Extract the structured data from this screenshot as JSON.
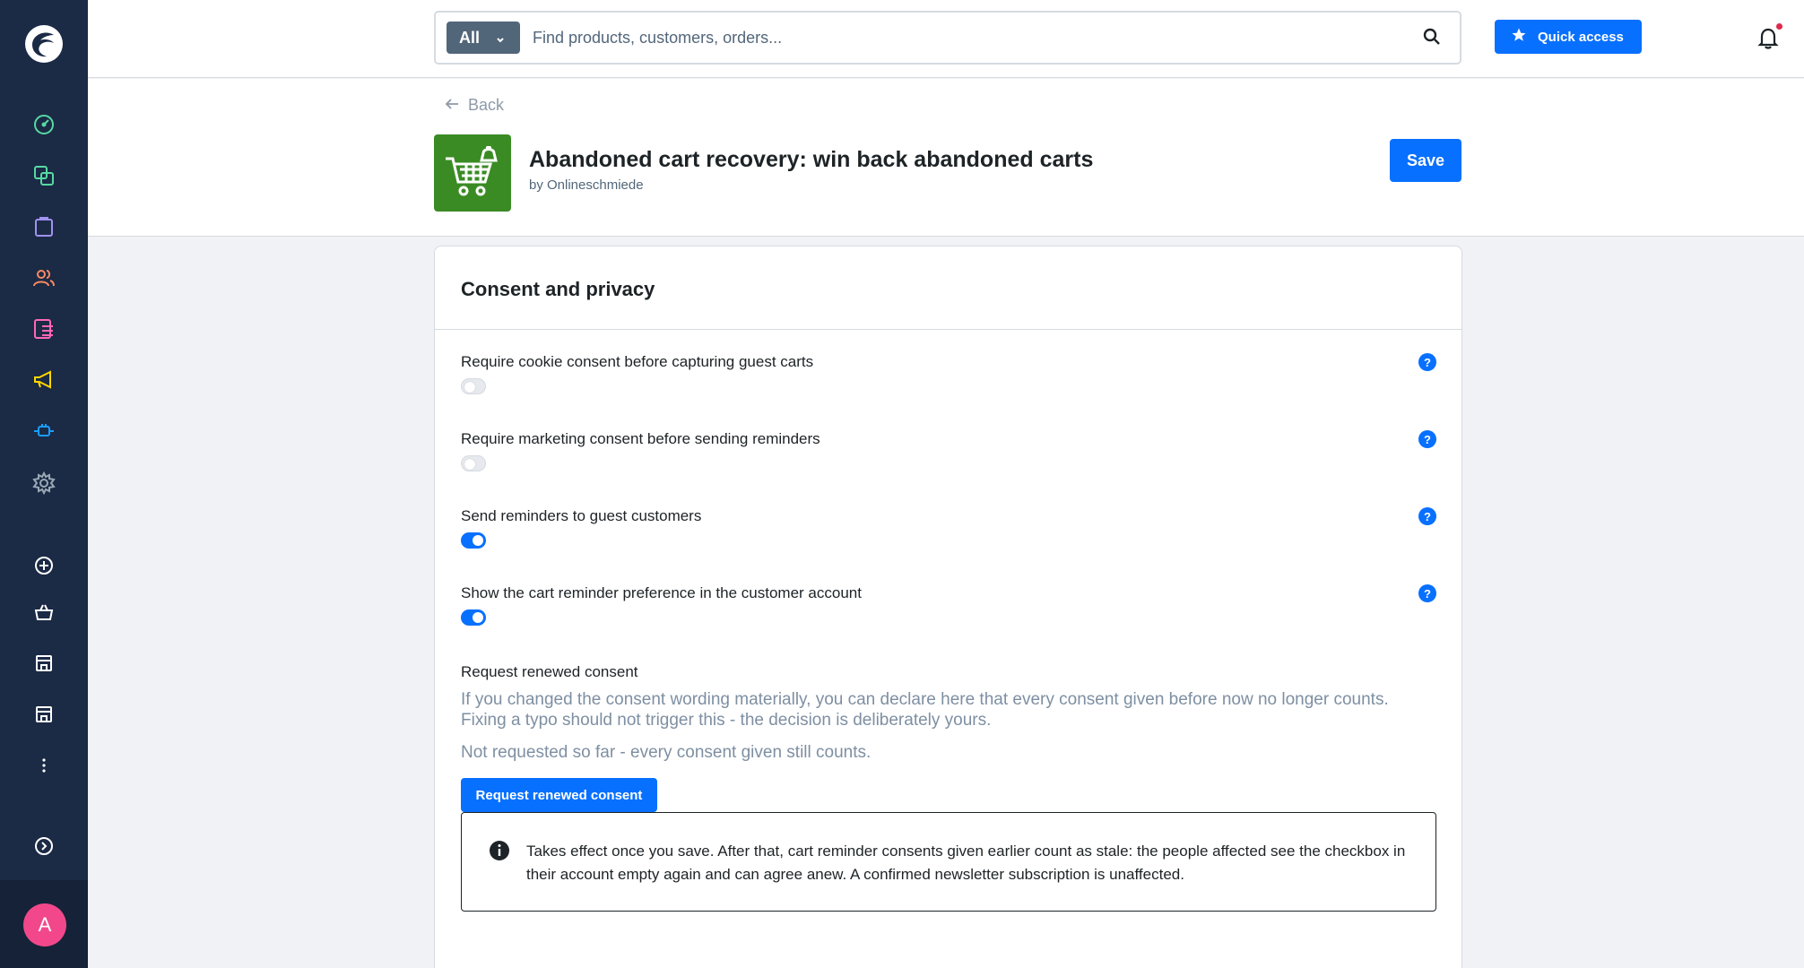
{
  "sidebar": {
    "logo": "shopware-logo",
    "items": [
      {
        "icon": "dashboard-icon",
        "color": "#57d9a3"
      },
      {
        "icon": "catalogue-icon",
        "color": "#57d9a3"
      },
      {
        "icon": "orders-icon",
        "color": "#a092f0"
      },
      {
        "icon": "customers-icon",
        "color": "#f88962"
      },
      {
        "icon": "content-icon",
        "color": "#ff68b4"
      },
      {
        "icon": "marketing-icon",
        "color": "#ffd700"
      },
      {
        "icon": "extensions-icon",
        "color": "#189eff"
      },
      {
        "icon": "settings-icon",
        "color": "#9aa8b5"
      },
      {
        "icon": "add-sales-channel-icon",
        "color": "#ffffff"
      },
      {
        "icon": "storefront-icon",
        "color": "#ffffff"
      },
      {
        "icon": "sales-channel-icon",
        "color": "#ffffff"
      },
      {
        "icon": "sales-channel-icon",
        "color": "#ffffff"
      },
      {
        "icon": "more-icon",
        "color": "#ffffff"
      },
      {
        "icon": "expand-icon",
        "color": "#ffffff"
      }
    ],
    "avatar_initial": "A"
  },
  "topbar": {
    "search_type": "All",
    "search_placeholder": "Find products, customers, orders...",
    "quick_access_label": "Quick access",
    "notification_dot_color": "#de294c"
  },
  "header": {
    "back_label": "Back",
    "plugin_title": "Abandoned cart recovery: win back abandoned carts",
    "plugin_author": "by Onlineschmiede",
    "save_label": "Save"
  },
  "card": {
    "title": "Consent and privacy",
    "settings": [
      {
        "label": "Require cookie consent before capturing guest carts",
        "enabled": false,
        "help": "?"
      },
      {
        "label": "Require marketing consent before sending reminders",
        "enabled": false,
        "help": "?"
      },
      {
        "label": "Send reminders to guest customers",
        "enabled": true,
        "help": "?"
      },
      {
        "label": "Show the cart reminder preference in the customer account",
        "enabled": true,
        "help": "?"
      }
    ],
    "renew": {
      "label": "Request renewed consent",
      "description": "If you changed the consent wording materially, you can declare here that every consent given before now no longer counts. Fixing a typo should not trigger this - the decision is deliberately yours.",
      "status": "Not requested so far - every consent given still counts.",
      "button_label": "Request renewed consent"
    },
    "notice": "Takes effect once you save. After that, cart reminder consents given earlier count as stale: the people affected see the checkbox in their account empty again and can agree anew. A confirmed newsletter subscription is unaffected."
  },
  "colors": {
    "primary": "#0870ff",
    "sidebar_bg": "#1b2a45",
    "plugin_logo_bg": "#3a8b24"
  }
}
